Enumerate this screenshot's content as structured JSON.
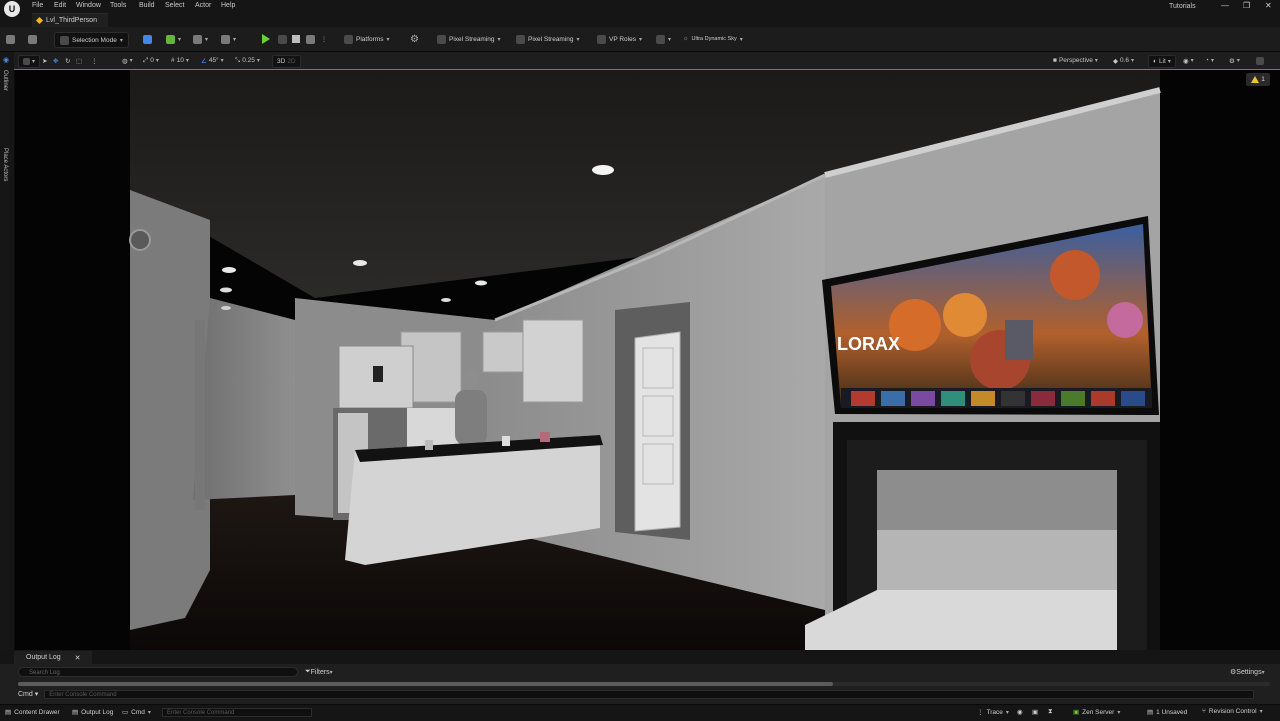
{
  "menu": [
    "File",
    "Edit",
    "Window",
    "Tools",
    "Build",
    "Select",
    "Actor",
    "Help"
  ],
  "level_tab": "Lvl_ThirdPerson",
  "project_name": "Tutorials",
  "window_controls": {
    "minimize": "—",
    "maximize": "❐",
    "close": "✕"
  },
  "toolbar": {
    "selection_mode": "Selection Mode",
    "platforms": "Platforms",
    "pixel_streaming_1": "Pixel Streaming",
    "pixel_streaming_2": "Pixel Streaming",
    "vp_roles": "VP Roles",
    "ultra_dynamic_sky": "Ultra Dynamic Sky"
  },
  "viewport_toolbar": {
    "rotation_snap": "0",
    "grid_snap": "10",
    "angle_snap": "45°",
    "scale_snap": "0.25",
    "three_d": "3D",
    "perspective": "Perspective",
    "fov": "0.6",
    "view_mode": "Lit",
    "warning_count": "1"
  },
  "left_sidebar": {
    "outliner": "Outliner",
    "place_actors": "Place Actors"
  },
  "scene": {
    "tv_title": "LORAX"
  },
  "output_log": {
    "tab": "Output Log",
    "search_placeholder": "Search Log",
    "filters": "Filters",
    "settings": "Settings",
    "cmd": "Cmd",
    "console_placeholder": "Enter Console Command"
  },
  "statusbar": {
    "content_drawer": "Content Drawer",
    "output_log": "Output Log",
    "cmd": "Cmd",
    "console_placeholder": "Enter Console Command",
    "trace": "Trace",
    "zen_server": "Zen Server",
    "unsaved": "1 Unsaved",
    "revision_control": "Revision Control"
  },
  "colors": {
    "accent_blue": "#3f88e6",
    "play_green": "#6ad038",
    "warning_yellow": "#f2c230",
    "level_icon": "#f0b429"
  }
}
